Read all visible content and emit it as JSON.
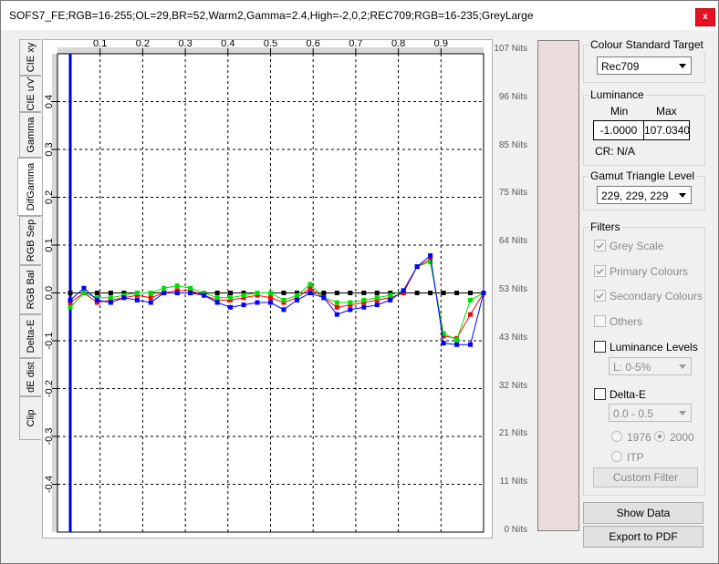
{
  "window": {
    "title": "SOFS7_FE;RGB=16-255;OL=29,BR=52,Warm2,Gamma=2.4,High=-2,0,2;REC709;RGB=16-235;GreyLarge",
    "close_label": "x"
  },
  "tabs": [
    "CIE xy",
    "CIE u'v'",
    "Gamma",
    "DifGamma",
    "RGB Sep",
    "RGB Bal",
    "Delta-E",
    "dE dist",
    "Clip"
  ],
  "active_tab": "DifGamma",
  "nits_labels": [
    "107 Nits",
    "96 Nits",
    "85 Nits",
    "75 Nits",
    "64 Nits",
    "53 Nits",
    "43 Nits",
    "32 Nits",
    "21 Nits",
    "11 Nits",
    "0 Nits"
  ],
  "colour_standard": {
    "label": "Colour Standard Target",
    "value": "Rec709"
  },
  "luminance": {
    "label": "Luminance",
    "min_label": "Min",
    "max_label": "Max",
    "min_value": "-1.0000",
    "max_value": "107.0340",
    "cr": "CR: N/A"
  },
  "gamut": {
    "label": "Gamut Triangle Level",
    "value": "229, 229, 229"
  },
  "filters": {
    "label": "Filters",
    "grey_scale": "Grey Scale",
    "primary": "Primary Colours",
    "secondary": "Secondary Colours",
    "others": "Others",
    "luminance_levels": "Luminance Levels",
    "lum_range": "L:   0-5%",
    "delta_e": "Delta-E",
    "de_range": "0.0 - 0.5",
    "r1976": "1976",
    "r2000": "2000",
    "itp": "ITP",
    "custom_filter": "Custom Filter"
  },
  "buttons": {
    "show_data": "Show Data",
    "export_pdf": "Export to PDF"
  },
  "colors": {
    "red": "#ff0000",
    "green": "#00dd00",
    "blue": "#0000ff",
    "reference": "#000000",
    "marker": "#0000cc"
  },
  "chart_data": {
    "type": "line",
    "xlim": [
      0,
      1
    ],
    "ylim": [
      -0.5,
      0.5
    ],
    "xticks": [
      0.1,
      0.2,
      0.3,
      0.4,
      0.5,
      0.6,
      0.7,
      0.8,
      0.9
    ],
    "xtick_labels": [
      "0.1",
      "0.2",
      "0.3",
      "0.4",
      "0.5",
      "0.6",
      "0.7",
      "0.8",
      "0.9"
    ],
    "yticks": [
      0.4,
      0.3,
      0.2,
      0.1,
      0,
      -0.1,
      -0.2,
      -0.3,
      -0.4
    ],
    "ytick_labels": [
      "0.4",
      "0.3",
      "0.2",
      "0.1",
      "0.0",
      "-0.1",
      "-0.2",
      "-0.3",
      "-0.4"
    ],
    "grid": true,
    "marker_x": 0.03,
    "x": [
      0.03,
      0.062,
      0.093,
      0.125,
      0.156,
      0.187,
      0.219,
      0.25,
      0.281,
      0.312,
      0.344,
      0.375,
      0.406,
      0.437,
      0.469,
      0.5,
      0.531,
      0.562,
      0.593,
      0.625,
      0.656,
      0.687,
      0.719,
      0.75,
      0.781,
      0.812,
      0.844,
      0.875,
      0.906,
      0.937,
      0.969,
      1.0
    ],
    "series": [
      {
        "color": "red",
        "values": [
          -0.02,
          0.0,
          -0.02,
          -0.015,
          -0.01,
          -0.005,
          -0.01,
          0.0,
          0.005,
          0.005,
          -0.005,
          -0.015,
          -0.015,
          -0.01,
          -0.005,
          -0.01,
          -0.02,
          -0.01,
          0.01,
          -0.01,
          -0.03,
          -0.025,
          -0.02,
          -0.015,
          -0.01,
          0.0,
          0.055,
          0.07,
          -0.09,
          -0.095,
          -0.045,
          0.0
        ]
      },
      {
        "color": "green",
        "values": [
          -0.03,
          0.0,
          -0.01,
          -0.01,
          -0.005,
          0.0,
          0.0,
          0.01,
          0.015,
          0.01,
          0.0,
          -0.01,
          -0.01,
          -0.005,
          0.0,
          0.0,
          -0.015,
          -0.005,
          0.018,
          -0.01,
          -0.02,
          -0.02,
          -0.015,
          -0.01,
          -0.005,
          0.005,
          0.055,
          0.065,
          -0.085,
          -0.098,
          -0.015,
          0.0
        ]
      },
      {
        "color": "blue",
        "values": [
          -0.015,
          0.01,
          -0.015,
          -0.02,
          -0.01,
          -0.015,
          -0.02,
          0.0,
          0.0,
          0.0,
          -0.005,
          -0.02,
          -0.03,
          -0.025,
          -0.02,
          -0.02,
          -0.035,
          -0.015,
          0.0,
          -0.01,
          -0.045,
          -0.035,
          -0.03,
          -0.025,
          -0.015,
          0.005,
          0.055,
          0.078,
          -0.105,
          -0.108,
          -0.108,
          0.0
        ]
      },
      {
        "color": "reference",
        "values": [
          0,
          0,
          0,
          0,
          0,
          0,
          0,
          0,
          0,
          0,
          0,
          0,
          0,
          0,
          0,
          0,
          0,
          0,
          0,
          0,
          0,
          0,
          0,
          0,
          0,
          0,
          0,
          0,
          0,
          0,
          0,
          0
        ]
      }
    ]
  }
}
